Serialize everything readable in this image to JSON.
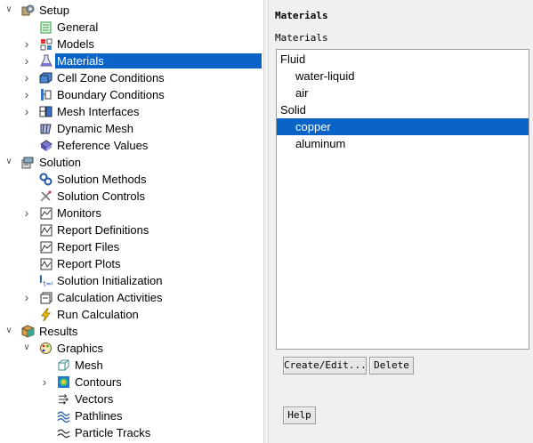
{
  "tree": [
    {
      "key": "setup",
      "label": "Setup",
      "depth": 0,
      "arrow": "down",
      "icon": "setup-icon"
    },
    {
      "key": "general",
      "label": "General",
      "depth": 1,
      "arrow": "",
      "icon": "general-icon"
    },
    {
      "key": "models",
      "label": "Models",
      "depth": 1,
      "arrow": "right",
      "icon": "models-icon"
    },
    {
      "key": "materials",
      "label": "Materials",
      "depth": 1,
      "arrow": "right",
      "icon": "materials-icon",
      "selected": true
    },
    {
      "key": "cell-zone-conditions",
      "label": "Cell Zone Conditions",
      "depth": 1,
      "arrow": "right",
      "icon": "cell-zone-icon"
    },
    {
      "key": "boundary-conditions",
      "label": "Boundary Conditions",
      "depth": 1,
      "arrow": "right",
      "icon": "boundary-icon"
    },
    {
      "key": "mesh-interfaces",
      "label": "Mesh Interfaces",
      "depth": 1,
      "arrow": "right",
      "icon": "mesh-interfaces-icon"
    },
    {
      "key": "dynamic-mesh",
      "label": "Dynamic Mesh",
      "depth": 1,
      "arrow": "",
      "icon": "dynamic-mesh-icon"
    },
    {
      "key": "reference-values",
      "label": "Reference Values",
      "depth": 1,
      "arrow": "",
      "icon": "reference-values-icon"
    },
    {
      "key": "solution",
      "label": "Solution",
      "depth": 0,
      "arrow": "down",
      "icon": "solution-icon"
    },
    {
      "key": "solution-methods",
      "label": "Solution Methods",
      "depth": 1,
      "arrow": "",
      "icon": "solution-methods-icon"
    },
    {
      "key": "solution-controls",
      "label": "Solution Controls",
      "depth": 1,
      "arrow": "",
      "icon": "solution-controls-icon"
    },
    {
      "key": "monitors",
      "label": "Monitors",
      "depth": 1,
      "arrow": "right",
      "icon": "monitors-icon"
    },
    {
      "key": "report-definitions",
      "label": "Report Definitions",
      "depth": 1,
      "arrow": "",
      "icon": "report-definitions-icon"
    },
    {
      "key": "report-files",
      "label": "Report Files",
      "depth": 1,
      "arrow": "",
      "icon": "report-files-icon"
    },
    {
      "key": "report-plots",
      "label": "Report Plots",
      "depth": 1,
      "arrow": "",
      "icon": "report-plots-icon"
    },
    {
      "key": "solution-initialization",
      "label": "Solution Initialization",
      "depth": 1,
      "arrow": "",
      "icon": "solution-initialization-icon"
    },
    {
      "key": "calculation-activities",
      "label": "Calculation Activities",
      "depth": 1,
      "arrow": "right",
      "icon": "calculation-activities-icon"
    },
    {
      "key": "run-calculation",
      "label": "Run Calculation",
      "depth": 1,
      "arrow": "",
      "icon": "run-calculation-icon"
    },
    {
      "key": "results",
      "label": "Results",
      "depth": 0,
      "arrow": "down",
      "icon": "results-icon"
    },
    {
      "key": "graphics",
      "label": "Graphics",
      "depth": 1,
      "arrow": "down",
      "icon": "graphics-icon"
    },
    {
      "key": "mesh",
      "label": "Mesh",
      "depth": 2,
      "arrow": "",
      "icon": "mesh-icon"
    },
    {
      "key": "contours",
      "label": "Contours",
      "depth": 2,
      "arrow": "right",
      "icon": "contours-icon"
    },
    {
      "key": "vectors",
      "label": "Vectors",
      "depth": 2,
      "arrow": "",
      "icon": "vectors-icon"
    },
    {
      "key": "pathlines",
      "label": "Pathlines",
      "depth": 2,
      "arrow": "",
      "icon": "pathlines-icon"
    },
    {
      "key": "particle-tracks",
      "label": "Particle Tracks",
      "depth": 2,
      "arrow": "",
      "icon": "particle-tracks-icon"
    }
  ],
  "panel": {
    "title": "Materials",
    "list_label": "Materials",
    "list": [
      {
        "label": "Fluid",
        "type": "group"
      },
      {
        "label": "water-liquid",
        "type": "item"
      },
      {
        "label": "air",
        "type": "item"
      },
      {
        "label": "Solid",
        "type": "group"
      },
      {
        "label": "copper",
        "type": "item",
        "selected": true
      },
      {
        "label": "aluminum",
        "type": "item"
      }
    ],
    "create_edit_label": "Create/Edit...",
    "delete_label": "Delete",
    "help_label": "Help"
  },
  "colors": {
    "selection": "#0a64c8",
    "panel_bg": "#f0f0f0"
  }
}
